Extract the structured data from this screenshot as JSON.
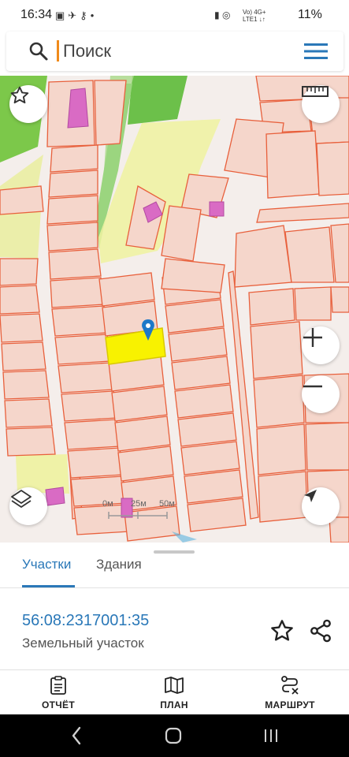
{
  "status_bar": {
    "time": "16:34",
    "battery": "11%",
    "network_top": "Vo) 4G+",
    "network_bottom": "LTE1 ↓↑"
  },
  "search": {
    "placeholder": "Поиск"
  },
  "map": {
    "scale_labels": [
      "0м",
      "25м",
      "50м"
    ]
  },
  "tabs": [
    {
      "label": "Участки",
      "active": true
    },
    {
      "label": "Здания",
      "active": false
    }
  ],
  "selected_parcel": {
    "cadastral_number": "56:08:2317001:35",
    "type": "Земельный участок"
  },
  "bottom_nav": [
    {
      "label": "ОТЧЁТ",
      "icon": "report-icon"
    },
    {
      "label": "ПЛАН",
      "icon": "map-icon"
    },
    {
      "label": "МАРШРУТ",
      "icon": "route-icon"
    }
  ],
  "colors": {
    "accent": "#2a78b8",
    "parcel_fill": "#f5d6cb",
    "parcel_stroke": "#e8603c",
    "selected_parcel": "#f8f200",
    "forest": "#7cc84a",
    "building": "#d96bc4",
    "caret": "#f08a1a"
  }
}
